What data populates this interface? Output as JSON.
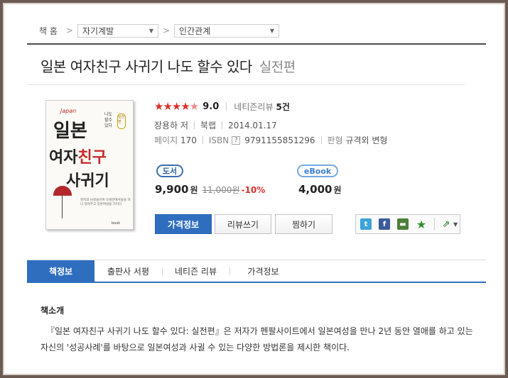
{
  "breadcrumb": {
    "home": "책 홈",
    "sep": ">",
    "cat1": "자기계발",
    "cat2": "인간관계"
  },
  "title": {
    "main": "일본 여자친구 사귀기 나도 할수 있다",
    "sub": "실전편"
  },
  "cover": {
    "japan": "Japan",
    "line1a": "일본",
    "line2a": "여자",
    "line2b": "친구",
    "line3": "사귀기",
    "tag": "나도 할수 있다",
    "badge": "실전편",
    "small": "현지의 남성들이며 유세한에서들을 하나 알려주고 일본여성을 가지다",
    "logo": "book"
  },
  "rating": {
    "stars": "★★★★",
    "half": "★",
    "score": "9.0",
    "review_label": "네티즌리뷰",
    "review_count": "5건"
  },
  "meta": {
    "author": "장용하 저",
    "publisher": "북랩",
    "date": "2014.01.17",
    "pages_label": "페이지",
    "pages": "170",
    "isbn_label": "ISBN",
    "isbn_q": "?",
    "isbn": "9791155851296",
    "format_label": "판형",
    "format": "규격외 변형"
  },
  "price": {
    "book_badge": "도서",
    "book_price": "9,900",
    "won": "원",
    "original": "11,000원",
    "discount": "-10%",
    "ebook_badge": "eBook",
    "ebook_price": "4,000"
  },
  "buttons": {
    "price_info": "가격정보",
    "write_review": "리뷰쓰기",
    "wish": "찜하기"
  },
  "share_icons": [
    "twitter-icon",
    "facebook-icon",
    "me2day-icon",
    "favorite-icon",
    "share-icon"
  ],
  "tabs": [
    "책정보",
    "출판사 서평",
    "네티즌 리뷰",
    "가격정보"
  ],
  "intro": {
    "heading": "책소개",
    "text": "『일본 여자친구 사귀기 나도 할수 있다: 실전편』은 저자가 펜팔사이트에서 일본여성을 만나 2년 동안 열애를 하고 있는 자신의 '성공사례'를 바탕으로 일본여성과 사귈 수 있는 다양한 방법론을 제시한 책이다."
  },
  "colors": {
    "accent": "#2f6ebf",
    "star": "#d9312b",
    "frame": "#6b5a52"
  }
}
